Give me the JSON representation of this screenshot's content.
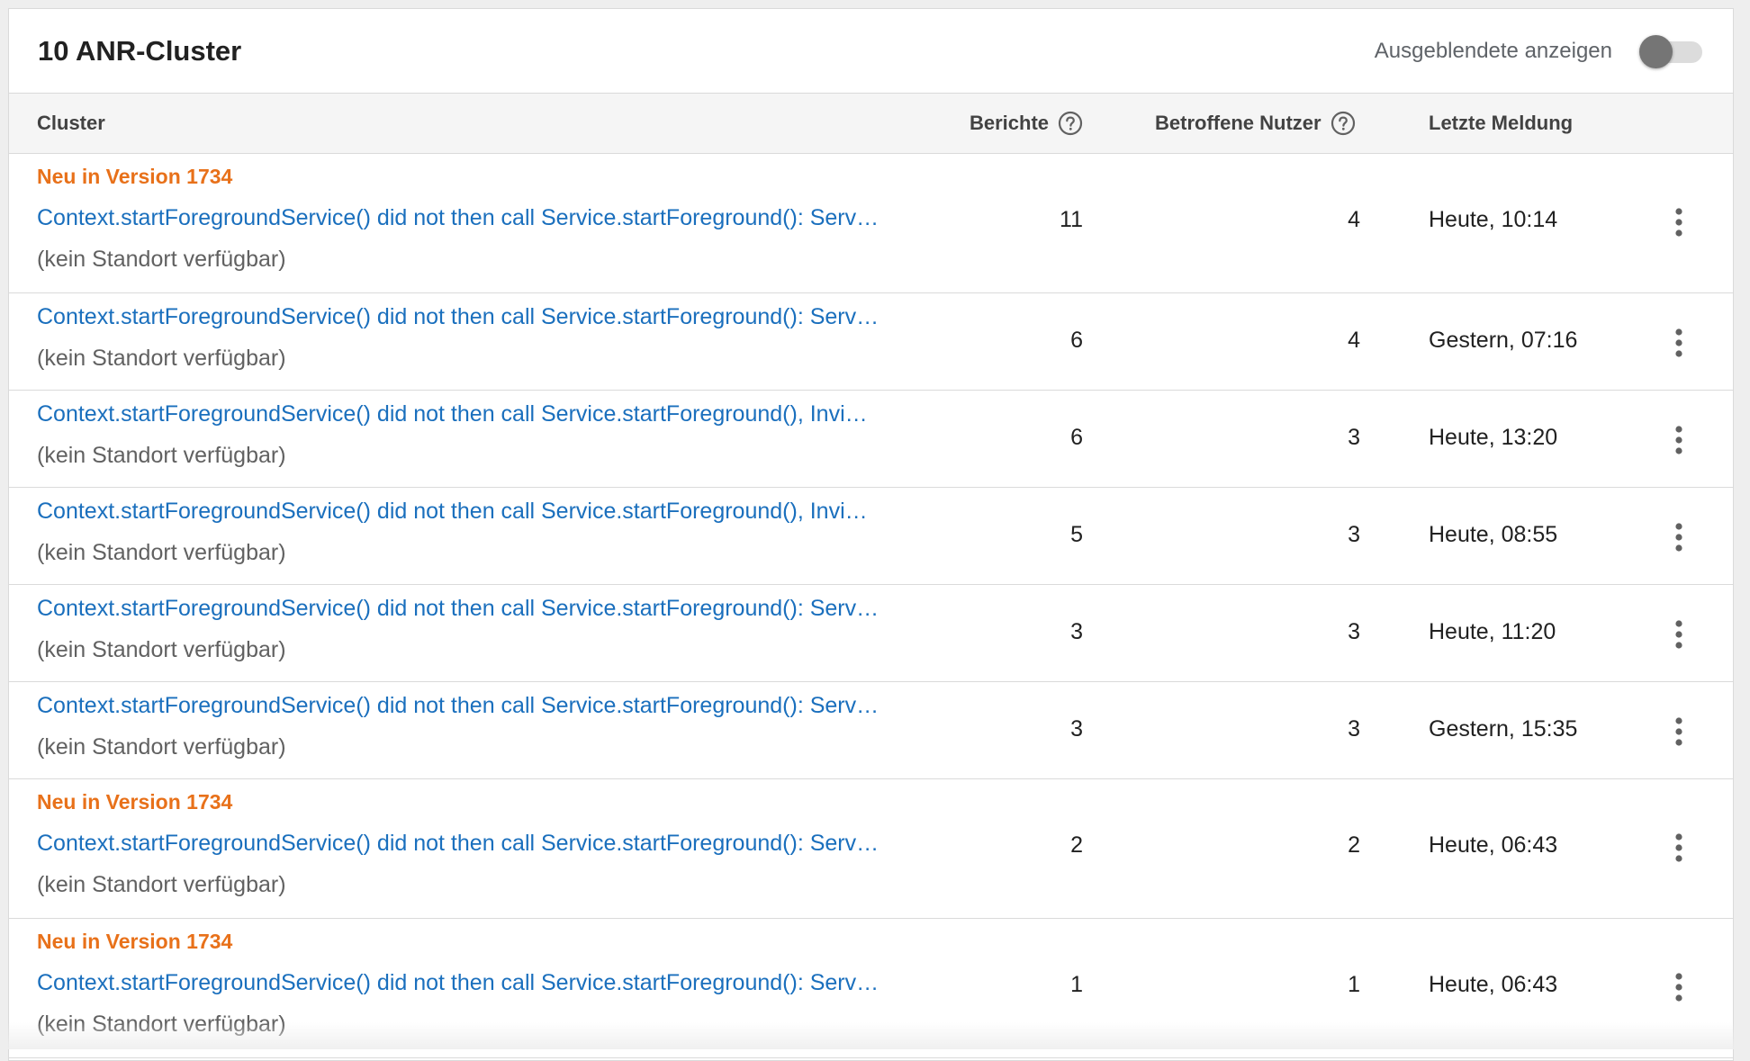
{
  "header": {
    "title": "10 ANR-Cluster",
    "toggle_label": "Ausgeblendete anzeigen",
    "toggle_on": false
  },
  "columns": {
    "cluster": "Cluster",
    "reports": "Berichte",
    "users": "Betroffene Nutzer",
    "last": "Letzte Meldung"
  },
  "colors": {
    "link": "#1a6fbd",
    "badge": "#e8711a",
    "toggle_thumb": "#757575"
  },
  "rows": [
    {
      "badge": "Neu in Version 1734",
      "title": "Context.startForegroundService() did not then call Service.startForeground(): Serv…",
      "location": "(kein Standort verfügbar)",
      "reports": "11",
      "users": "4",
      "last": "Heute, 10:14"
    },
    {
      "badge": "",
      "title": "Context.startForegroundService() did not then call Service.startForeground(): Serv…",
      "location": "(kein Standort verfügbar)",
      "reports": "6",
      "users": "4",
      "last": "Gestern, 07:16"
    },
    {
      "badge": "",
      "title": "Context.startForegroundService() did not then call Service.startForeground(), Invi…",
      "location": "(kein Standort verfügbar)",
      "reports": "6",
      "users": "3",
      "last": "Heute, 13:20"
    },
    {
      "badge": "",
      "title": "Context.startForegroundService() did not then call Service.startForeground(), Invi…",
      "location": "(kein Standort verfügbar)",
      "reports": "5",
      "users": "3",
      "last": "Heute, 08:55"
    },
    {
      "badge": "",
      "title": "Context.startForegroundService() did not then call Service.startForeground(): Serv…",
      "location": "(kein Standort verfügbar)",
      "reports": "3",
      "users": "3",
      "last": "Heute, 11:20"
    },
    {
      "badge": "",
      "title": "Context.startForegroundService() did not then call Service.startForeground(): Serv…",
      "location": "(kein Standort verfügbar)",
      "reports": "3",
      "users": "3",
      "last": "Gestern, 15:35"
    },
    {
      "badge": "Neu in Version 1734",
      "title": "Context.startForegroundService() did not then call Service.startForeground(): Serv…",
      "location": "(kein Standort verfügbar)",
      "reports": "2",
      "users": "2",
      "last": "Heute, 06:43"
    },
    {
      "badge": "Neu in Version 1734",
      "title": "Context.startForegroundService() did not then call Service.startForeground(): Serv…",
      "location": "(kein Standort verfügbar)",
      "reports": "1",
      "users": "1",
      "last": "Heute, 06:43"
    }
  ]
}
